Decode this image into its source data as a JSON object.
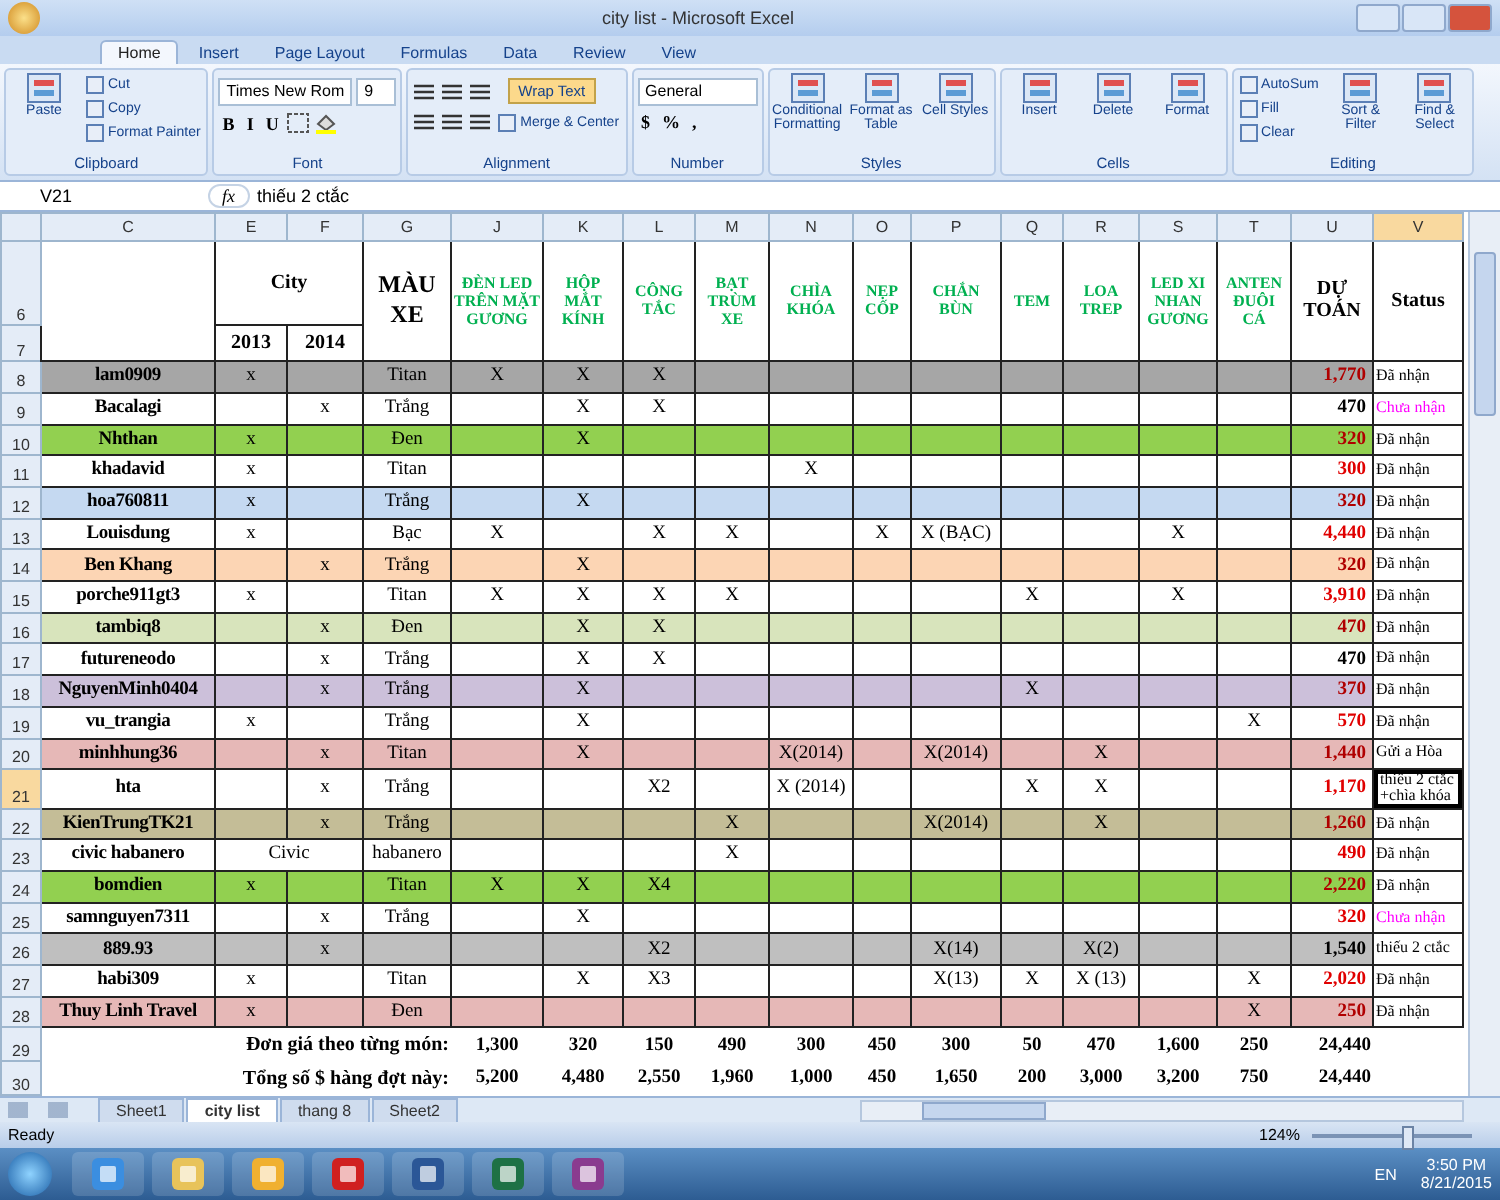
{
  "window": {
    "title": "city list - Microsoft Excel"
  },
  "ribbon_tabs": [
    {
      "label": "Home",
      "selected": true
    },
    {
      "label": "Insert",
      "selected": false
    },
    {
      "label": "Page Layout",
      "selected": false
    },
    {
      "label": "Formulas",
      "selected": false
    },
    {
      "label": "Data",
      "selected": false
    },
    {
      "label": "Review",
      "selected": false
    },
    {
      "label": "View",
      "selected": false
    }
  ],
  "ribbon_groups": [
    {
      "label": "Clipboard",
      "kind": "columns",
      "items": [
        {
          "kind": "big",
          "label": "Paste"
        },
        {
          "kind": "small",
          "label": "Cut"
        },
        {
          "kind": "small",
          "label": "Copy"
        },
        {
          "kind": "small",
          "label": "Format Painter"
        }
      ]
    },
    {
      "label": "Font",
      "kind": "rows",
      "rows": [
        {
          "items": [
            {
              "kind": "field",
              "label": "Times New Rom"
            },
            {
              "kind": "field",
              "label": "9"
            }
          ]
        },
        {
          "items": [
            {
              "kind": "glyph",
              "label": "B"
            },
            {
              "kind": "glyph",
              "label": "I"
            },
            {
              "kind": "glyph",
              "label": "U"
            },
            {
              "kind": "border"
            },
            {
              "kind": "fill"
            }
          ]
        }
      ]
    },
    {
      "label": "Alignment",
      "kind": "rows",
      "rows": [
        {
          "items": [
            {
              "kind": "align"
            },
            {
              "kind": "align"
            },
            {
              "kind": "align"
            },
            {
              "kind": "toggle",
              "label": "Wrap Text",
              "on": true
            }
          ]
        },
        {
          "items": [
            {
              "kind": "align"
            },
            {
              "kind": "align"
            },
            {
              "kind": "align"
            },
            {
              "kind": "small",
              "label": "Merge & Center"
            }
          ]
        }
      ]
    },
    {
      "label": "Number",
      "kind": "rows",
      "rows": [
        {
          "items": [
            {
              "kind": "field",
              "label": "General"
            }
          ]
        },
        {
          "items": [
            {
              "kind": "glyph",
              "label": "$"
            },
            {
              "kind": "glyph",
              "label": "%"
            },
            {
              "kind": "glyph",
              "label": ","
            }
          ]
        }
      ]
    },
    {
      "label": "Styles",
      "kind": "columns",
      "items": [
        {
          "kind": "big",
          "label": "Conditional Formatting"
        },
        {
          "kind": "big",
          "label": "Format as Table"
        },
        {
          "kind": "big",
          "label": "Cell Styles"
        }
      ]
    },
    {
      "label": "Cells",
      "kind": "columns",
      "items": [
        {
          "kind": "big",
          "label": "Insert"
        },
        {
          "kind": "big",
          "label": "Delete"
        },
        {
          "kind": "big",
          "label": "Format"
        }
      ]
    },
    {
      "label": "Editing",
      "kind": "columns",
      "items": [
        {
          "kind": "small",
          "label": "AutoSum"
        },
        {
          "kind": "small",
          "label": "Fill"
        },
        {
          "kind": "small",
          "label": "Clear"
        },
        {
          "kind": "big",
          "label": "Sort & Filter"
        },
        {
          "kind": "big",
          "label": "Find & Select"
        }
      ]
    }
  ],
  "formula_bar": {
    "name_box": "V21",
    "fx": "fx",
    "value": "thiếu 2 ctắc"
  },
  "columns": [
    {
      "label": "C",
      "selected": false
    },
    {
      "label": "E",
      "selected": false
    },
    {
      "label": "F",
      "selected": false
    },
    {
      "label": "G",
      "selected": false
    },
    {
      "label": "J",
      "selected": false
    },
    {
      "label": "K",
      "selected": false
    },
    {
      "label": "L",
      "selected": false
    },
    {
      "label": "M",
      "selected": false
    },
    {
      "label": "N",
      "selected": false
    },
    {
      "label": "O",
      "selected": false
    },
    {
      "label": "P",
      "selected": false
    },
    {
      "label": "Q",
      "selected": false
    },
    {
      "label": "R",
      "selected": false
    },
    {
      "label": "S",
      "selected": false
    },
    {
      "label": "T",
      "selected": false
    },
    {
      "label": "U",
      "selected": false
    },
    {
      "label": "V",
      "selected": true
    }
  ],
  "header": {
    "row_numbers": [
      "6",
      "7"
    ],
    "city": "City",
    "years": [
      "2013",
      "2014"
    ],
    "car_color": "MÀU XE",
    "items": [
      "ĐÈN LED TRÊN MẶT GƯƠNG",
      "HỘP MẮT KÍNH",
      "CÔNG TẮC",
      "BẠT TRÙM XE",
      "CHÌA KHÓA",
      "NẸP CỐP",
      "CHẮN BÙN",
      "TEM",
      "LOA TREP",
      "LED XI NHAN GƯƠNG",
      "ANTEN ĐUÔI CÁ"
    ],
    "estimate": "DỰ TOÁN",
    "status": "Status"
  },
  "rows": [
    {
      "row": "8",
      "name": "lam0909",
      "color": "#a6a6a6",
      "y2013": "x",
      "car_color": "Titan",
      "items": {
        "J": "X",
        "K": "X",
        "L": "X"
      },
      "total": "1,770",
      "flagged": true,
      "status": "Đã nhận",
      "pending": false,
      "active": false
    },
    {
      "row": "9",
      "name": "Bacalagi",
      "y2014": "x",
      "car_color": "Trắng",
      "items": {
        "K": "X",
        "L": "X"
      },
      "total": "470",
      "flagged": false,
      "status": "Chưa nhận",
      "pending": true,
      "active": false
    },
    {
      "row": "10",
      "name": "Nhthan",
      "color": "#92d050",
      "y2013": "x",
      "car_color": "Đen",
      "items": {
        "K": "X"
      },
      "total": "320",
      "flagged": true,
      "status": "Đã nhận",
      "pending": false,
      "active": false
    },
    {
      "row": "11",
      "name": "khadavid",
      "y2013": "x",
      "car_color": "Titan",
      "items": {
        "N": "X"
      },
      "total": "300",
      "flagged": true,
      "status": "Đã nhận",
      "pending": false,
      "active": false
    },
    {
      "row": "12",
      "name": "hoa760811",
      "color": "#c5d9f1",
      "y2013": "x",
      "car_color": "Trắng",
      "items": {
        "K": "X"
      },
      "total": "320",
      "flagged": true,
      "status": "Đã nhận",
      "pending": false,
      "active": false
    },
    {
      "row": "13",
      "name": "Louisdung",
      "y2013": "x",
      "car_color": "Bạc",
      "items": {
        "J": "X",
        "L": "X",
        "M": "X",
        "O": "X",
        "P": "X (BẠC)",
        "S": "X"
      },
      "total": "4,440",
      "flagged": true,
      "status": "Đã nhận",
      "pending": false,
      "active": false
    },
    {
      "row": "14",
      "name": "Ben Khang",
      "color": "#fcd5b4",
      "y2014": "x",
      "car_color": "Trắng",
      "items": {
        "K": "X"
      },
      "total": "320",
      "flagged": true,
      "status": "Đã nhận",
      "pending": false,
      "active": false
    },
    {
      "row": "15",
      "name": "porche911gt3",
      "y2013": "x",
      "car_color": "Titan",
      "items": {
        "J": "X",
        "K": "X",
        "L": "X",
        "M": "X",
        "Q": "X",
        "S": "X"
      },
      "total": "3,910",
      "flagged": true,
      "status": "Đã nhận",
      "pending": false,
      "active": false
    },
    {
      "row": "16",
      "name": "tambiq8",
      "color": "#d8e4bc",
      "y2014": "x",
      "car_color": "Đen",
      "items": {
        "K": "X",
        "L": "X"
      },
      "total": "470",
      "flagged": true,
      "status": "Đã nhận",
      "pending": false,
      "active": false
    },
    {
      "row": "17",
      "name": "futureneodo",
      "y2014": "x",
      "car_color": "Trắng",
      "items": {
        "K": "X",
        "L": "X"
      },
      "total": "470",
      "flagged": false,
      "status": "Đã nhận",
      "pending": false,
      "active": false
    },
    {
      "row": "18",
      "name": "NguyenMinh0404",
      "color": "#ccc0da",
      "y2014": "x",
      "car_color": "Trắng",
      "items": {
        "K": "X",
        "Q": "X"
      },
      "total": "370",
      "flagged": true,
      "status": "Đã nhận",
      "pending": false,
      "active": false
    },
    {
      "row": "19",
      "name": "vu_trangia",
      "y2013": "x",
      "car_color": "Trắng",
      "items": {
        "K": "X",
        "T": "X"
      },
      "total": "570",
      "flagged": true,
      "status": "Đã nhận",
      "pending": false,
      "active": false
    },
    {
      "row": "20",
      "name": "minhhung36",
      "color": "#e6b8b7",
      "y2014": "x",
      "car_color": "Titan",
      "items": {
        "K": "X",
        "N": "X(2014)",
        "P": "X(2014)",
        "R": "X"
      },
      "total": "1,440",
      "flagged": true,
      "status": "Gửi a Hòa",
      "pending": false,
      "active": false
    },
    {
      "row": "21",
      "name": "hta",
      "y2014": "x",
      "car_color": "Trắng",
      "items": {
        "L": "X2",
        "N": "X (2014)",
        "Q": "X",
        "R": "X"
      },
      "total": "1,170",
      "flagged": true,
      "status": "thiếu 2 ctắc +chìa khóa",
      "pending": false,
      "active": true
    },
    {
      "row": "22",
      "name": "KienTrungTK21",
      "color": "#c4bd97",
      "y2014": "x",
      "car_color": "Trắng",
      "items": {
        "M": "X",
        "P": "X(2014)",
        "R": "X"
      },
      "total": "1,260",
      "flagged": true,
      "status": "Đã nhận",
      "pending": false,
      "active": false
    },
    {
      "row": "23",
      "name": "civic habanero",
      "city_merged": "Civic",
      "car_color": "habanero",
      "items": {
        "M": "X"
      },
      "total": "490",
      "flagged": true,
      "status": "Đã nhận",
      "pending": false,
      "active": false
    },
    {
      "row": "24",
      "name": "bomdien",
      "color": "#92d050",
      "y2013": "x",
      "car_color": "Titan",
      "items": {
        "J": "X",
        "K": "X",
        "L": "X4"
      },
      "total": "2,220",
      "flagged": true,
      "status": "Đã nhận",
      "pending": false,
      "active": false
    },
    {
      "row": "25",
      "name": "samnguyen7311",
      "y2014": "x",
      "car_color": "Trắng",
      "items": {
        "K": "X"
      },
      "total": "320",
      "flagged": true,
      "status": "Chưa nhận",
      "pending": true,
      "active": false
    },
    {
      "row": "26",
      "name": "889.93",
      "color": "#bfbfbf",
      "y2014": "x",
      "items": {
        "L": "X2",
        "P": "X(14)",
        "R": "X(2)"
      },
      "total": "1,540",
      "flagged": false,
      "status": "thiếu 2 ctắc",
      "pending": false,
      "active": false
    },
    {
      "row": "27",
      "name": "habi309",
      "y2013": "x",
      "car_color": "Titan",
      "items": {
        "K": "X",
        "L": "X3",
        "P": "X(13)",
        "Q": "X",
        "R": "X (13)",
        "T": "X"
      },
      "total": "2,020",
      "flagged": true,
      "status": "Đã nhận",
      "pending": false,
      "active": false
    },
    {
      "row": "28",
      "name": "Thuy Linh Travel",
      "color": "#e6b8b7",
      "y2013": "x",
      "car_color": "Đen",
      "items": {
        "T": "X"
      },
      "total": "250",
      "flagged": true,
      "status": "Đã nhận",
      "pending": false,
      "active": false
    }
  ],
  "footer": [
    {
      "row": "29",
      "label": "Đơn giá theo từng món:",
      "values": [
        "1,300",
        "320",
        "150",
        "490",
        "300",
        "450",
        "300",
        "50",
        "470",
        "1,600",
        "250",
        "24,440"
      ]
    },
    {
      "row": "30",
      "label": "Tổng số $ hàng đợt này:",
      "values": [
        "5,200",
        "4,480",
        "2,550",
        "1,960",
        "1,000",
        "450",
        "1,650",
        "200",
        "3,000",
        "3,200",
        "750",
        "24,440"
      ]
    }
  ],
  "sheet_tabs": [
    {
      "label": "Sheet1",
      "selected": false
    },
    {
      "label": "city list",
      "selected": true
    },
    {
      "label": "thang 8",
      "selected": false
    },
    {
      "label": "Sheet2",
      "selected": false
    }
  ],
  "status_bar": {
    "text": "Ready",
    "zoom": "124%",
    "zoom_slider": {
      "level": 0.6
    }
  },
  "taskbar": {
    "language": "EN",
    "time": "3:50 PM",
    "date": "8/21/2015"
  }
}
